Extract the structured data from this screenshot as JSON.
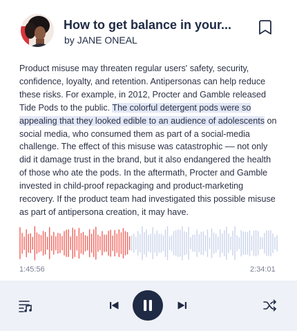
{
  "header": {
    "title": "How to get balance in your...",
    "byline_prefix": "by",
    "author": "JANE ONEAL"
  },
  "article": {
    "before": "Product misuse may threaten regular users' safety, security, confidence, loyalty, and retention. Antipersonas can help reduce these risks. For example, in 2012, Procter and Gamble released Tide Pods to the public. ",
    "highlight": "The colorful detergent pods were so appealing that they looked edible to an audience of adolescents",
    "after": " on social media, who consumed them as part of a social-media challenge. The effect of this misuse was catastrophic –– not only did it damage trust in the brand, but it also endangered the health of those who ate the pods. In the aftermath, Procter and Gamble invested in child-proof repackaging and product-marketing recovery. If the product team had investigated this possible misuse as part of antipersona creation, it may have."
  },
  "player": {
    "current_time": "1:45:56",
    "total_time": "2:34:01",
    "progress": 0.43,
    "played_color": "#f0625a",
    "unplayed_color": "#c9d3ea",
    "accent_dark": "#1f2a44",
    "controls_bg": "#eef1f7",
    "icons": {
      "bookmark": "bookmark-icon",
      "playlist": "playlist-icon",
      "previous": "skip-previous-icon",
      "pause": "pause-icon",
      "next": "skip-next-icon",
      "shuffle": "shuffle-icon"
    }
  }
}
